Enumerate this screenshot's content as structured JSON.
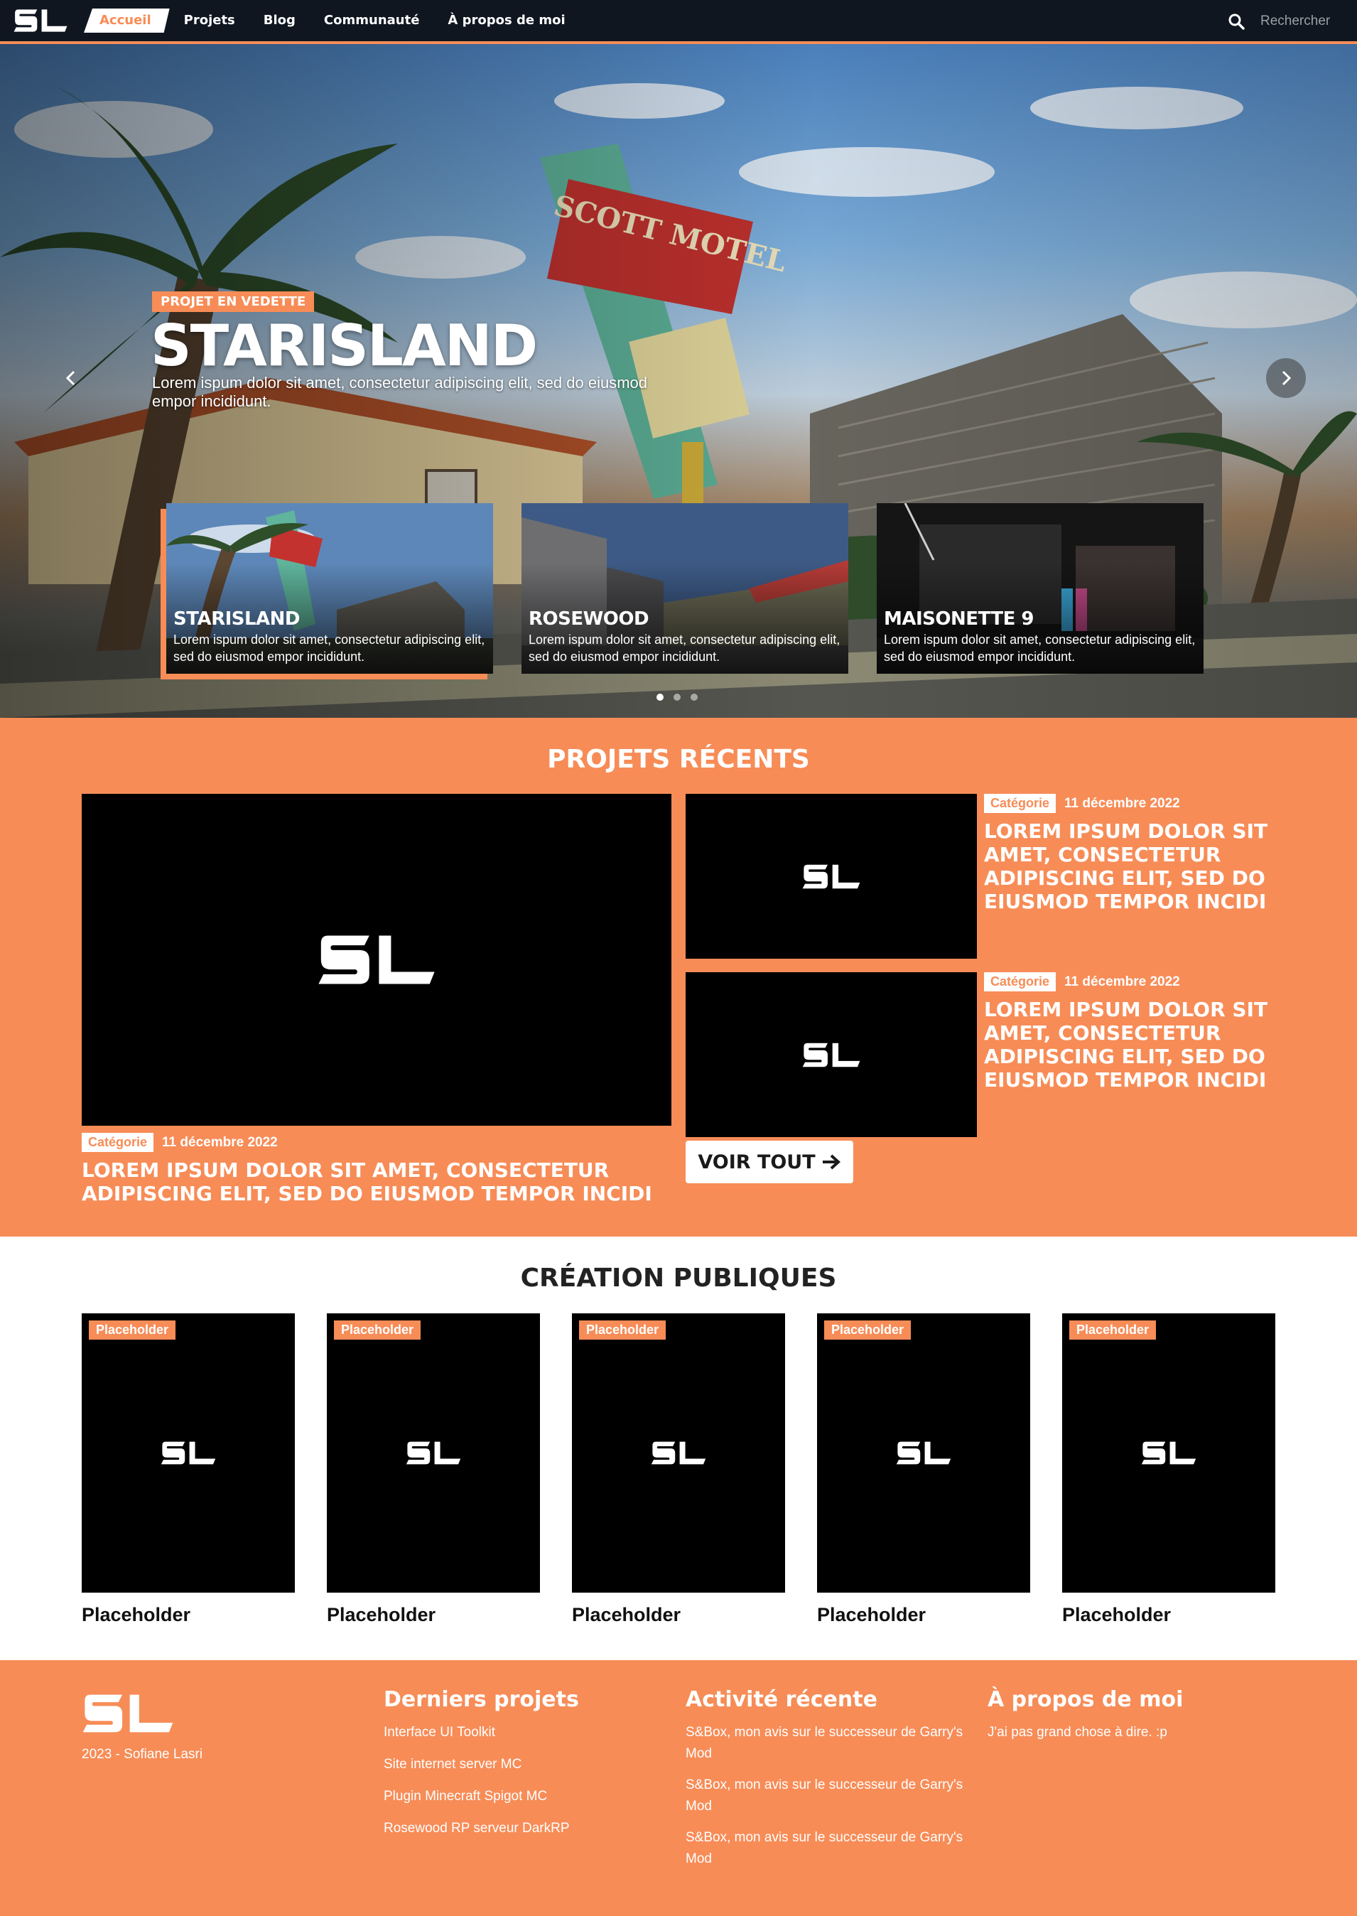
{
  "nav": {
    "logo": "SL",
    "items": [
      {
        "label": "Accueil",
        "active": true
      },
      {
        "label": "Projets"
      },
      {
        "label": "Blog"
      },
      {
        "label": "Communauté"
      },
      {
        "label": "À propos de moi"
      }
    ],
    "search_placeholder": "Rechercher",
    "accent": "#f78c57",
    "background": "#0f1620"
  },
  "hero": {
    "badge": "PROJET EN VEDETTE",
    "title": "STARISLAND",
    "description": "Lorem ispum dolor sit amet, consectetur adipiscing elit, sed do eiusmod empor incididunt.",
    "cards": [
      {
        "title": "STARISLAND",
        "description": "Lorem ispum dolor sit amet, consectetur adipiscing elit, sed do eiusmod empor incididunt."
      },
      {
        "title": "ROSEWOOD",
        "description": "Lorem ispum dolor sit amet, consectetur adipiscing elit, sed do eiusmod empor incididunt."
      },
      {
        "title": "MAISONETTE 9",
        "description": "Lorem ispum dolor sit amet, consectetur adipiscing elit, sed do eiusmod empor incididunt."
      }
    ],
    "slides": 3,
    "active_slide": 1
  },
  "recent": {
    "title": "PROJETS RÉCENTS",
    "main": {
      "category": "Catégorie",
      "date": "11 décembre 2022",
      "title": "LOREM IPSUM DOLOR SIT AMET, CONSECTETUR ADIPISCING ELIT, SED DO EIUSMOD TEMPOR INCIDI"
    },
    "side": [
      {
        "category": "Catégorie",
        "date": "11 décembre 2022",
        "title": "LOREM IPSUM DOLOR SIT AMET, CONSECTETUR ADIPISCING ELIT, SED DO EIUSMOD TEMPOR INCIDI"
      },
      {
        "category": "Catégorie",
        "date": "11 décembre 2022",
        "title": "LOREM IPSUM DOLOR SIT AMET, CONSECTETUR ADIPISCING ELIT, SED DO EIUSMOD TEMPOR INCIDI"
      }
    ],
    "voir_tout": "VOIR TOUT"
  },
  "creations": {
    "title": "CRÉATION PUBLIQUES",
    "items": [
      {
        "tag": "Placeholder",
        "name": "Placeholder"
      },
      {
        "tag": "Placeholder",
        "name": "Placeholder"
      },
      {
        "tag": "Placeholder",
        "name": "Placeholder"
      },
      {
        "tag": "Placeholder",
        "name": "Placeholder"
      },
      {
        "tag": "Placeholder",
        "name": "Placeholder"
      }
    ]
  },
  "footer": {
    "copyright": "2023 - Sofiane Lasri",
    "projects": {
      "title": "Derniers projets",
      "links": [
        "Interface UI Toolkit",
        "Site internet server MC",
        "Plugin Minecraft Spigot MC",
        "Rosewood RP serveur DarkRP"
      ]
    },
    "activity": {
      "title": "Activité récente",
      "links": [
        "S&Box, mon avis sur le successeur de Garry's Mod",
        "S&Box, mon avis sur le successeur de Garry's Mod",
        "S&Box, mon avis sur le successeur de Garry's Mod"
      ]
    },
    "about": {
      "title": "À propos de moi",
      "text": "J'ai pas grand chose à dire. :p"
    }
  }
}
